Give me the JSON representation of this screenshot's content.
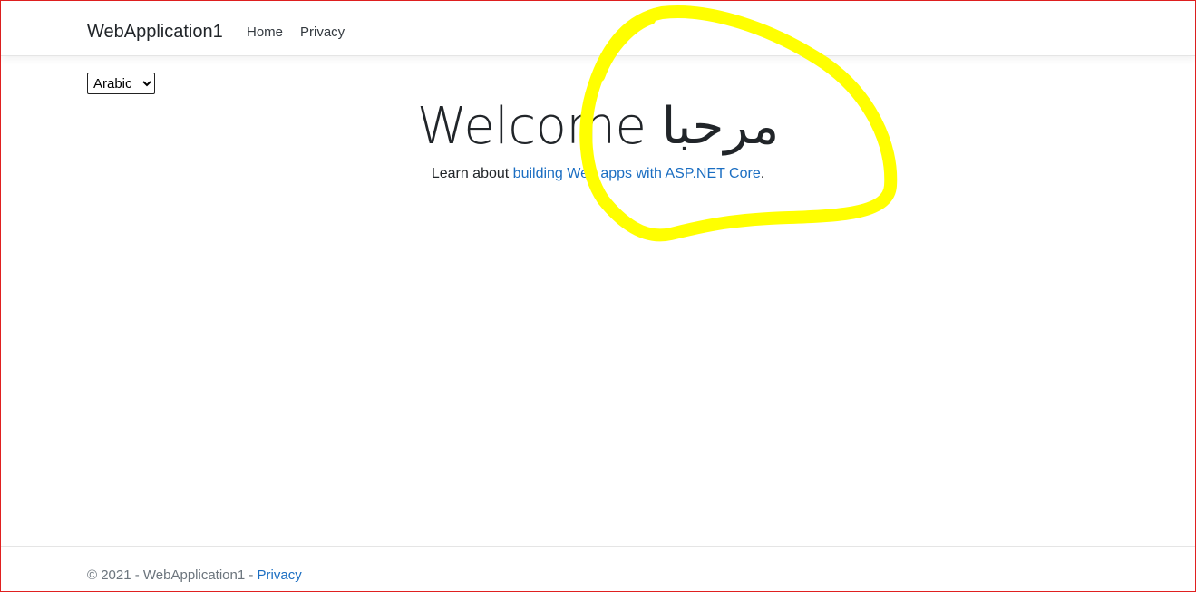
{
  "navbar": {
    "brand": "WebApplication1",
    "links": [
      {
        "label": "Home"
      },
      {
        "label": "Privacy"
      }
    ]
  },
  "language_select": {
    "selected": "Arabic"
  },
  "main": {
    "heading": "Welcome مرحبا",
    "lead_prefix": "Learn about ",
    "lead_link": "building Web apps with ASP.NET Core",
    "lead_suffix": "."
  },
  "footer": {
    "copyright": "© 2021 - WebApplication1 - ",
    "privacy_link": "Privacy"
  },
  "colors": {
    "link": "#1b6ec2",
    "annotation_highlight": "#ffff00",
    "frame_border": "#e02020"
  }
}
